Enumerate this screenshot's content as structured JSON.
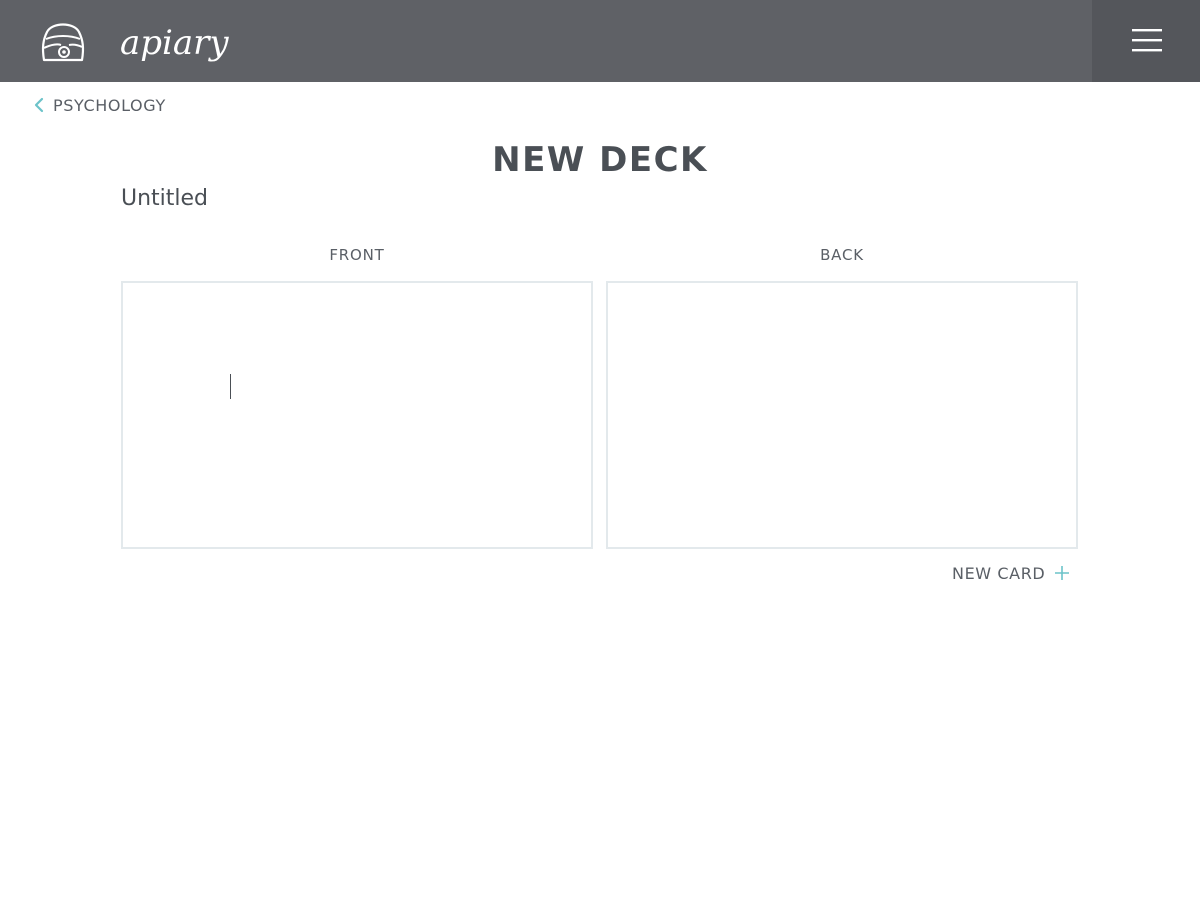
{
  "header": {
    "brand": "apiary",
    "logo_icon": "beehive-icon",
    "menu_icon": "hamburger-menu-icon"
  },
  "breadcrumb": {
    "icon": "chevron-left-icon",
    "label": "PSYCHOLOGY"
  },
  "page": {
    "title": "NEW DECK",
    "deck_name": "Untitled"
  },
  "card_editor": {
    "front_label": "FRONT",
    "back_label": "BACK",
    "front_value": "",
    "back_value": ""
  },
  "actions": {
    "new_card_label": "NEW CARD",
    "new_card_icon": "plus-icon"
  },
  "colors": {
    "topbar": "#5f6166",
    "menu_button": "#54565b",
    "accent": "#6cc3c9",
    "text": "#4a4f55",
    "card_border": "#e3e9ec"
  }
}
